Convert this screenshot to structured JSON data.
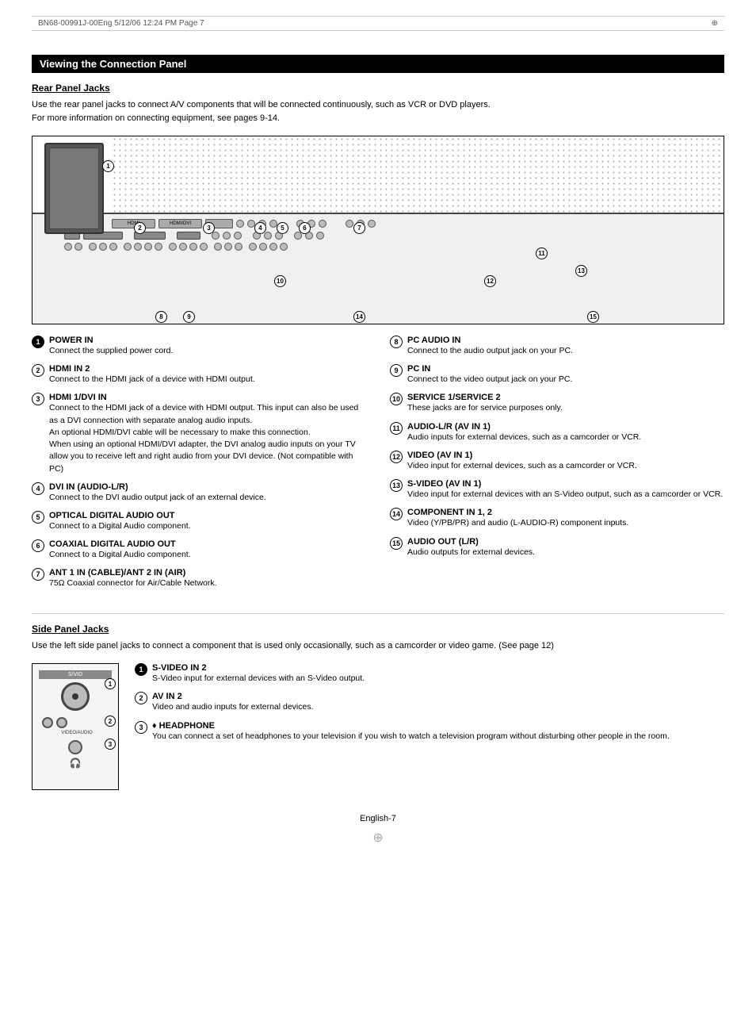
{
  "header": {
    "print_info": "BN68-00991J-00Eng   5/12/06   12:24 PM   Page 7"
  },
  "main_section": {
    "title": "Viewing the Connection Panel",
    "rear_panel": {
      "heading": "Rear Panel Jacks",
      "description_line1": "Use the rear panel jacks to connect A/V components that will be connected continuously, such as VCR or DVD players.",
      "description_line2": "For more information on connecting equipment, see pages 9-14."
    },
    "items": [
      {
        "num": "1",
        "filled": true,
        "title": "POWER IN",
        "desc": "Connect the supplied power cord."
      },
      {
        "num": "2",
        "filled": false,
        "title": "HDMI IN 2",
        "desc": "Connect to the HDMI jack of a device with HDMI output."
      },
      {
        "num": "3",
        "filled": false,
        "title": "HDMI 1/DVI IN",
        "desc": "Connect to the HDMI jack of a device with HDMI output. This input can also be used as a DVI connection with separate analog audio inputs.\nAn optional HDMI/DVI cable will be necessary to make this connection.\nWhen using an optional HDMI/DVI adapter, the DVI analog audio inputs on your TV allow you to receive left and right audio from your DVI device. (Not compatible with PC)"
      },
      {
        "num": "4",
        "filled": false,
        "title": "DVI IN (AUDIO-L/R)",
        "desc": "Connect to the DVI audio output jack of an external device."
      },
      {
        "num": "5",
        "filled": false,
        "title": "OPTICAL DIGITAL AUDIO OUT",
        "desc": "Connect to a Digital Audio component."
      },
      {
        "num": "6",
        "filled": false,
        "title": "COAXIAL DIGITAL AUDIO OUT",
        "desc": "Connect to a Digital Audio component."
      },
      {
        "num": "7",
        "filled": false,
        "title": "ANT 1 IN (CABLE)/ANT 2 IN (AIR)",
        "desc": "75Ω Coaxial connector for Air/Cable Network."
      },
      {
        "num": "8",
        "filled": false,
        "title": "PC AUDIO IN",
        "desc": "Connect to the audio output jack on your PC.",
        "right": true
      },
      {
        "num": "9",
        "filled": false,
        "title": "PC IN",
        "desc": "Connect to the video output jack on your PC.",
        "right": true
      },
      {
        "num": "10",
        "filled": false,
        "title": "SERVICE 1/SERVICE 2",
        "desc": "These jacks are for service purposes only.",
        "right": true
      },
      {
        "num": "11",
        "filled": false,
        "title": "AUDIO-L/R (AV IN 1)",
        "desc": "Audio inputs for external devices, such as a camcorder or VCR.",
        "right": true
      },
      {
        "num": "12",
        "filled": false,
        "title": "VIDEO (AV IN 1)",
        "desc": "Video input for external devices, such as a camcorder or VCR.",
        "right": true
      },
      {
        "num": "13",
        "filled": false,
        "title": "S-VIDEO (AV IN 1)",
        "desc": "Video input for external devices with an S-Video output, such as a camcorder or VCR.",
        "right": true
      },
      {
        "num": "14",
        "filled": false,
        "title": "COMPONENT IN 1, 2",
        "desc": "Video (Y/PB/PR) and audio (L-AUDIO-R) component inputs.",
        "right": true
      },
      {
        "num": "15",
        "filled": false,
        "title": "AUDIO OUT (L/R)",
        "desc": "Audio outputs for external devices.",
        "right": true
      }
    ],
    "side_panel": {
      "heading": "Side Panel Jacks",
      "description": "Use the left side panel jacks to connect a component that is used only occasionally, such as a camcorder or video game. (See page 12)",
      "items": [
        {
          "num": "1",
          "filled": true,
          "title": "S-VIDEO IN 2",
          "desc": "S-Video input for external devices with an S-Video output."
        },
        {
          "num": "2",
          "filled": false,
          "title": "AV IN 2",
          "desc": "Video and audio inputs for external devices."
        },
        {
          "num": "3",
          "filled": false,
          "title": "♦ HEADPHONE",
          "desc": "You can connect a set of headphones to your television if you wish to watch a television program without disturbing other people in the room."
        }
      ]
    },
    "page_number": "English-7"
  }
}
